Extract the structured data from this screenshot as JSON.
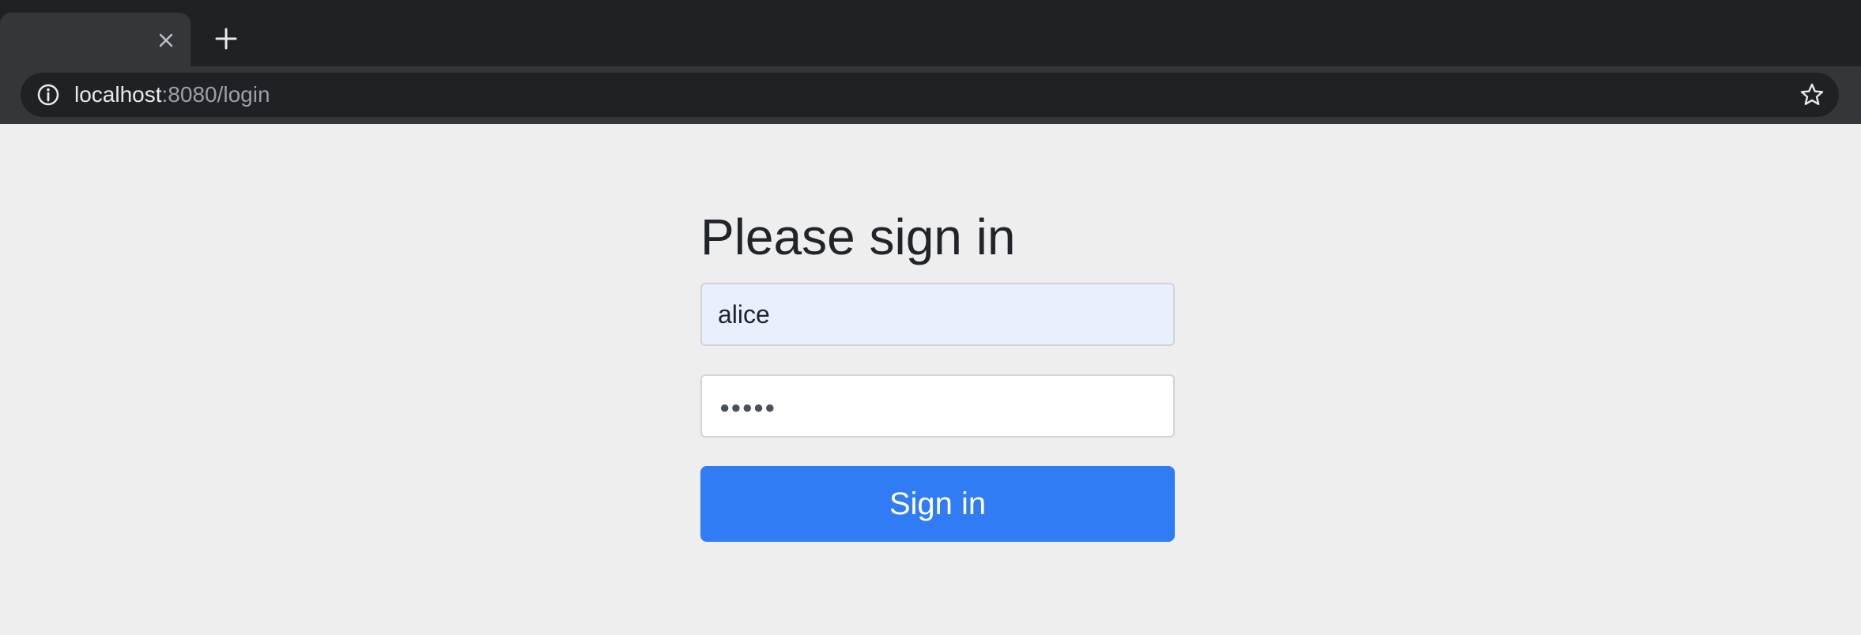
{
  "browser": {
    "new_tab_symbol": "+",
    "close_tab_symbol": "×",
    "url_host": "localhost",
    "url_rest": ":8080/login"
  },
  "form": {
    "heading": "Please sign in",
    "username_value": "alice",
    "password_mask": "●●●●●",
    "submit_label": "Sign in"
  },
  "colors": {
    "page_background": "#eeeeee",
    "primary_button": "#307cf5",
    "autofill_background": "#e8f0fe",
    "chrome_dark": "#202124"
  },
  "icons": {
    "tab_close": "close-icon",
    "new_tab": "plus-icon",
    "site_info": "info-icon",
    "bookmark": "star-icon"
  }
}
